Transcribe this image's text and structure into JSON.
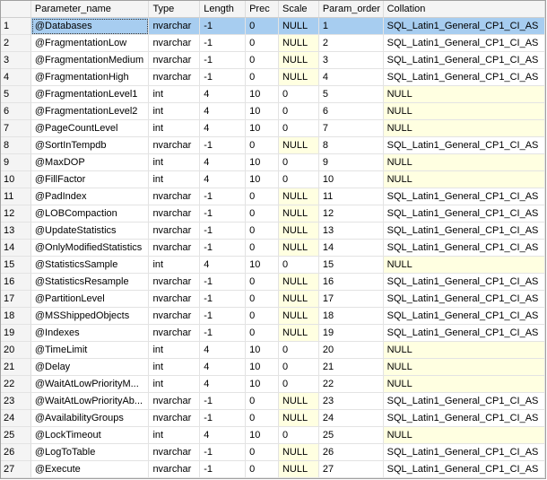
{
  "columns": [
    "",
    "Parameter_name",
    "Type",
    "Length",
    "Prec",
    "Scale",
    "Param_order",
    "Collation"
  ],
  "rows": [
    [
      "1",
      "@Databases",
      "nvarchar",
      "-1",
      "0",
      "NULL",
      "1",
      "SQL_Latin1_General_CP1_CI_AS"
    ],
    [
      "2",
      "@FragmentationLow",
      "nvarchar",
      "-1",
      "0",
      "NULL",
      "2",
      "SQL_Latin1_General_CP1_CI_AS"
    ],
    [
      "3",
      "@FragmentationMedium",
      "nvarchar",
      "-1",
      "0",
      "NULL",
      "3",
      "SQL_Latin1_General_CP1_CI_AS"
    ],
    [
      "4",
      "@FragmentationHigh",
      "nvarchar",
      "-1",
      "0",
      "NULL",
      "4",
      "SQL_Latin1_General_CP1_CI_AS"
    ],
    [
      "5",
      "@FragmentationLevel1",
      "int",
      "4",
      "10",
      "0",
      "5",
      "NULL"
    ],
    [
      "6",
      "@FragmentationLevel2",
      "int",
      "4",
      "10",
      "0",
      "6",
      "NULL"
    ],
    [
      "7",
      "@PageCountLevel",
      "int",
      "4",
      "10",
      "0",
      "7",
      "NULL"
    ],
    [
      "8",
      "@SortInTempdb",
      "nvarchar",
      "-1",
      "0",
      "NULL",
      "8",
      "SQL_Latin1_General_CP1_CI_AS"
    ],
    [
      "9",
      "@MaxDOP",
      "int",
      "4",
      "10",
      "0",
      "9",
      "NULL"
    ],
    [
      "10",
      "@FillFactor",
      "int",
      "4",
      "10",
      "0",
      "10",
      "NULL"
    ],
    [
      "11",
      "@PadIndex",
      "nvarchar",
      "-1",
      "0",
      "NULL",
      "11",
      "SQL_Latin1_General_CP1_CI_AS"
    ],
    [
      "12",
      "@LOBCompaction",
      "nvarchar",
      "-1",
      "0",
      "NULL",
      "12",
      "SQL_Latin1_General_CP1_CI_AS"
    ],
    [
      "13",
      "@UpdateStatistics",
      "nvarchar",
      "-1",
      "0",
      "NULL",
      "13",
      "SQL_Latin1_General_CP1_CI_AS"
    ],
    [
      "14",
      "@OnlyModifiedStatistics",
      "nvarchar",
      "-1",
      "0",
      "NULL",
      "14",
      "SQL_Latin1_General_CP1_CI_AS"
    ],
    [
      "15",
      "@StatisticsSample",
      "int",
      "4",
      "10",
      "0",
      "15",
      "NULL"
    ],
    [
      "16",
      "@StatisticsResample",
      "nvarchar",
      "-1",
      "0",
      "NULL",
      "16",
      "SQL_Latin1_General_CP1_CI_AS"
    ],
    [
      "17",
      "@PartitionLevel",
      "nvarchar",
      "-1",
      "0",
      "NULL",
      "17",
      "SQL_Latin1_General_CP1_CI_AS"
    ],
    [
      "18",
      "@MSShippedObjects",
      "nvarchar",
      "-1",
      "0",
      "NULL",
      "18",
      "SQL_Latin1_General_CP1_CI_AS"
    ],
    [
      "19",
      "@Indexes",
      "nvarchar",
      "-1",
      "0",
      "NULL",
      "19",
      "SQL_Latin1_General_CP1_CI_AS"
    ],
    [
      "20",
      "@TimeLimit",
      "int",
      "4",
      "10",
      "0",
      "20",
      "NULL"
    ],
    [
      "21",
      "@Delay",
      "int",
      "4",
      "10",
      "0",
      "21",
      "NULL"
    ],
    [
      "22",
      "@WaitAtLowPriorityM...",
      "int",
      "4",
      "10",
      "0",
      "22",
      "NULL"
    ],
    [
      "23",
      "@WaitAtLowPriorityAb...",
      "nvarchar",
      "-1",
      "0",
      "NULL",
      "23",
      "SQL_Latin1_General_CP1_CI_AS"
    ],
    [
      "24",
      "@AvailabilityGroups",
      "nvarchar",
      "-1",
      "0",
      "NULL",
      "24",
      "SQL_Latin1_General_CP1_CI_AS"
    ],
    [
      "25",
      "@LockTimeout",
      "int",
      "4",
      "10",
      "0",
      "25",
      "NULL"
    ],
    [
      "26",
      "@LogToTable",
      "nvarchar",
      "-1",
      "0",
      "NULL",
      "26",
      "SQL_Latin1_General_CP1_CI_AS"
    ],
    [
      "27",
      "@Execute",
      "nvarchar",
      "-1",
      "0",
      "NULL",
      "27",
      "SQL_Latin1_General_CP1_CI_AS"
    ]
  ],
  "selected_row_index": 0,
  "colors": {
    "null_bg": "#ffffe1",
    "selected_bg": "#a7cdf0",
    "header_bg": "#f4f4f4"
  }
}
